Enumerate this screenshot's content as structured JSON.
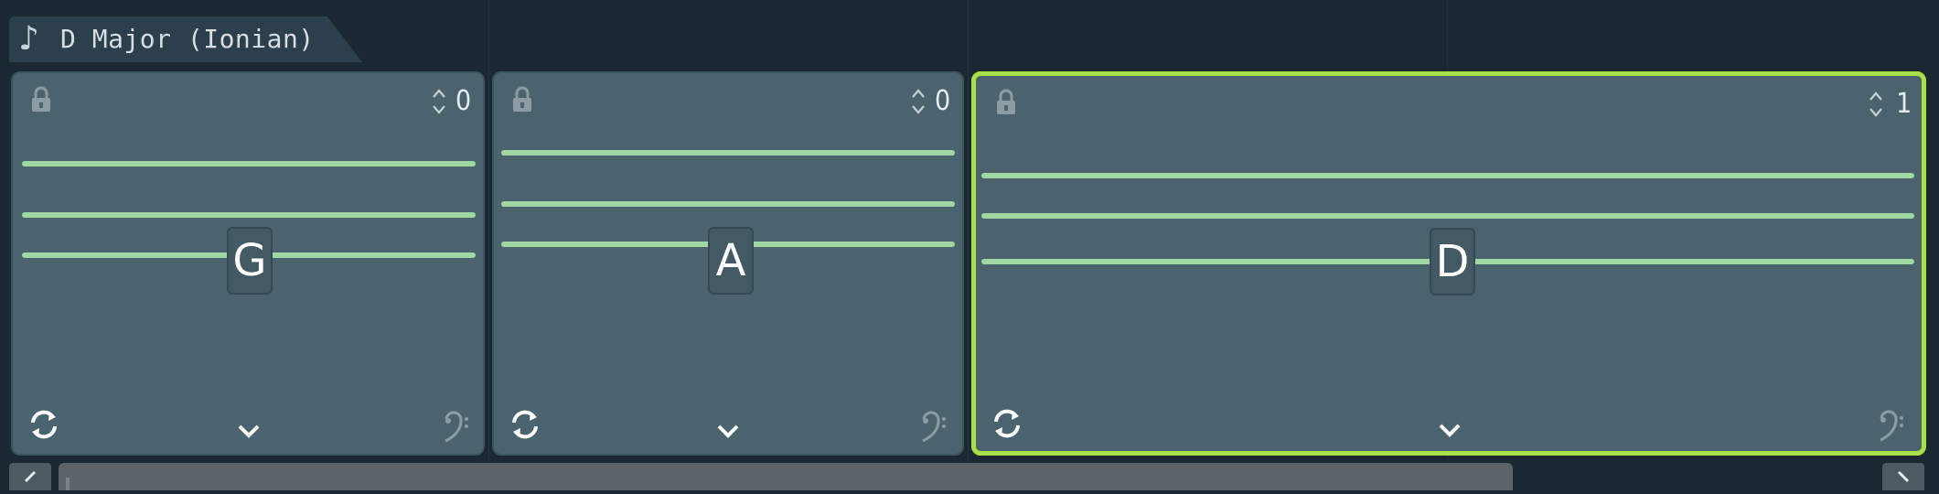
{
  "tab": {
    "label": "D Major (Ionian)",
    "icon": "music-note-icon"
  },
  "colors": {
    "background": "#1b2832",
    "panel": "#4b636e",
    "scale_line": "#9fd8a3",
    "selected_border": "#a9e04a"
  },
  "chords": [
    {
      "note": "G",
      "count": "0",
      "selected": false
    },
    {
      "note": "A",
      "count": "0",
      "selected": false
    },
    {
      "note": "D",
      "count": "1",
      "selected": true
    }
  ],
  "scrollbar": {
    "left_icon": "chevron-left-icon",
    "right_icon": "chevron-right-icon"
  }
}
